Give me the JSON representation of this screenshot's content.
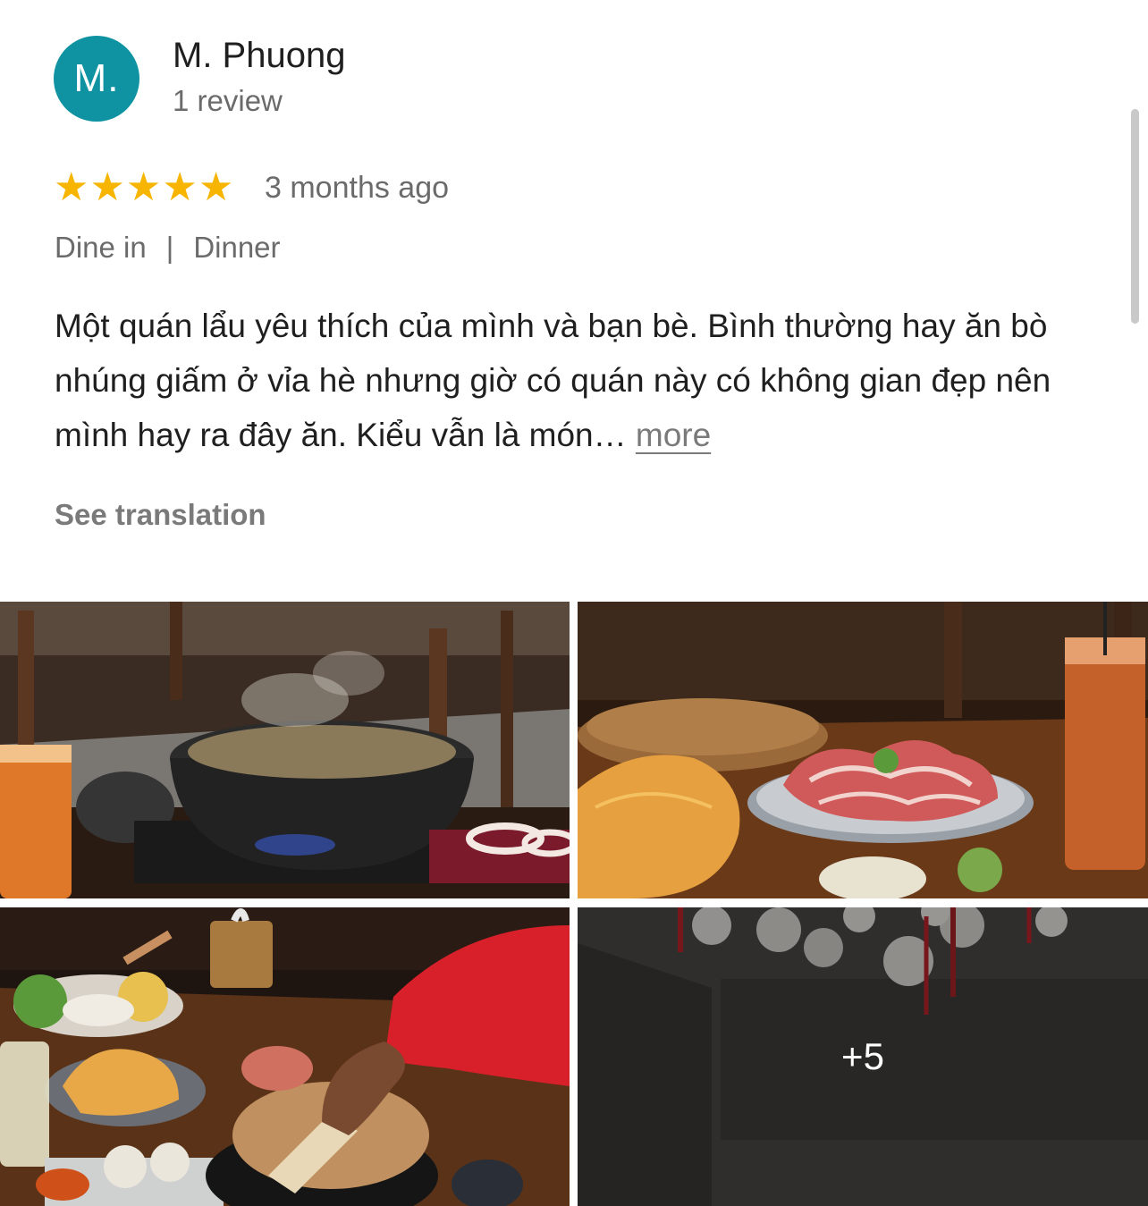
{
  "reviewer": {
    "initials": "M.",
    "name": "M. Phuong",
    "review_count": "1 review",
    "avatar_color": "#0f93a2"
  },
  "rating": {
    "stars": 5,
    "max_stars": 5,
    "star_color": "#f7b500",
    "time_ago": "3 months ago"
  },
  "tags": {
    "service": "Dine in",
    "separator": "|",
    "meal": "Dinner"
  },
  "review": {
    "text": "Một quán lẩu yêu thích của mình và bạn bè. Bình thường hay ăn bò nhúng giấm ở vỉa hè nhưng giờ có quán này có không gian đẹp nên mình hay ra đây ăn. Kiểu vẫn là món…",
    "more_label": "more"
  },
  "see_translation_label": "See translation",
  "photos": {
    "extra_count_label": "+5"
  }
}
